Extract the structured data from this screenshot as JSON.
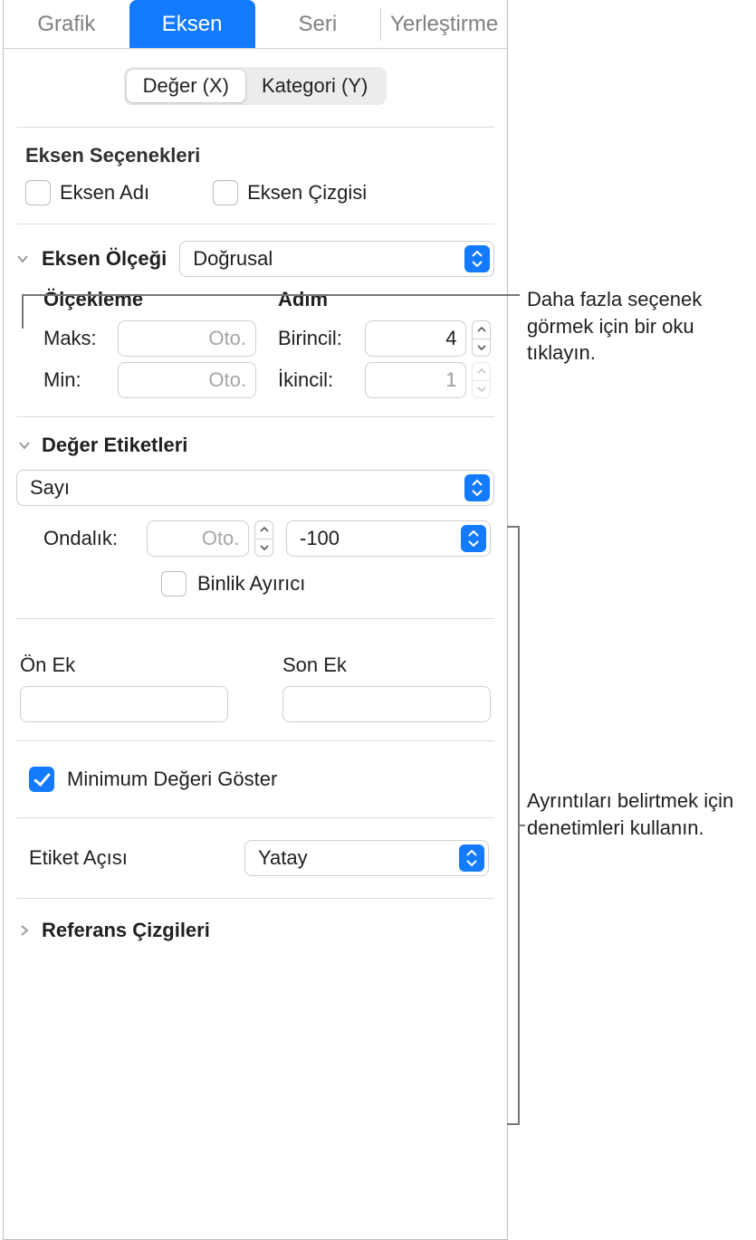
{
  "tabs": {
    "grafik": "Grafik",
    "eksen": "Eksen",
    "seri": "Seri",
    "yerlestirme": "Yerleştirme"
  },
  "segmented": {
    "degerX": "Değer (X)",
    "kategoriY": "Kategori (Y)"
  },
  "axisOptions": {
    "title": "Eksen Seçenekleri",
    "axisName": "Eksen Adı",
    "axisLine": "Eksen Çizgisi"
  },
  "axisScale": {
    "title": "Eksen Ölçeği",
    "select": "Doğrusal",
    "scalingHeader": "Ölçekleme",
    "stepsHeader": "Adım",
    "maxLabel": "Maks:",
    "minLabel": "Min:",
    "autoPlaceholder": "Oto.",
    "primaryLabel": "Birincil:",
    "secondaryLabel": "İkincil:",
    "primaryValue": "4",
    "secondaryValue": "1"
  },
  "valueLabels": {
    "title": "Değer Etiketleri",
    "format": "Sayı",
    "decimalsLabel": "Ondalık:",
    "decimalsPlaceholder": "Oto.",
    "neg": "-100",
    "thousands": "Binlik Ayırıcı",
    "prefixLabel": "Ön Ek",
    "suffixLabel": "Son Ek",
    "prefixValue": "",
    "suffixValue": "",
    "showMin": "Minimum Değeri Göster"
  },
  "labelAngle": {
    "label": "Etiket Açısı",
    "value": "Yatay"
  },
  "refLines": {
    "title": "Referans Çizgileri"
  },
  "callouts": {
    "c1": "Daha fazla seçenek görmek için bir oku tıklayın.",
    "c2": "Ayrıntıları belirtmek için denetimleri kullanın."
  }
}
